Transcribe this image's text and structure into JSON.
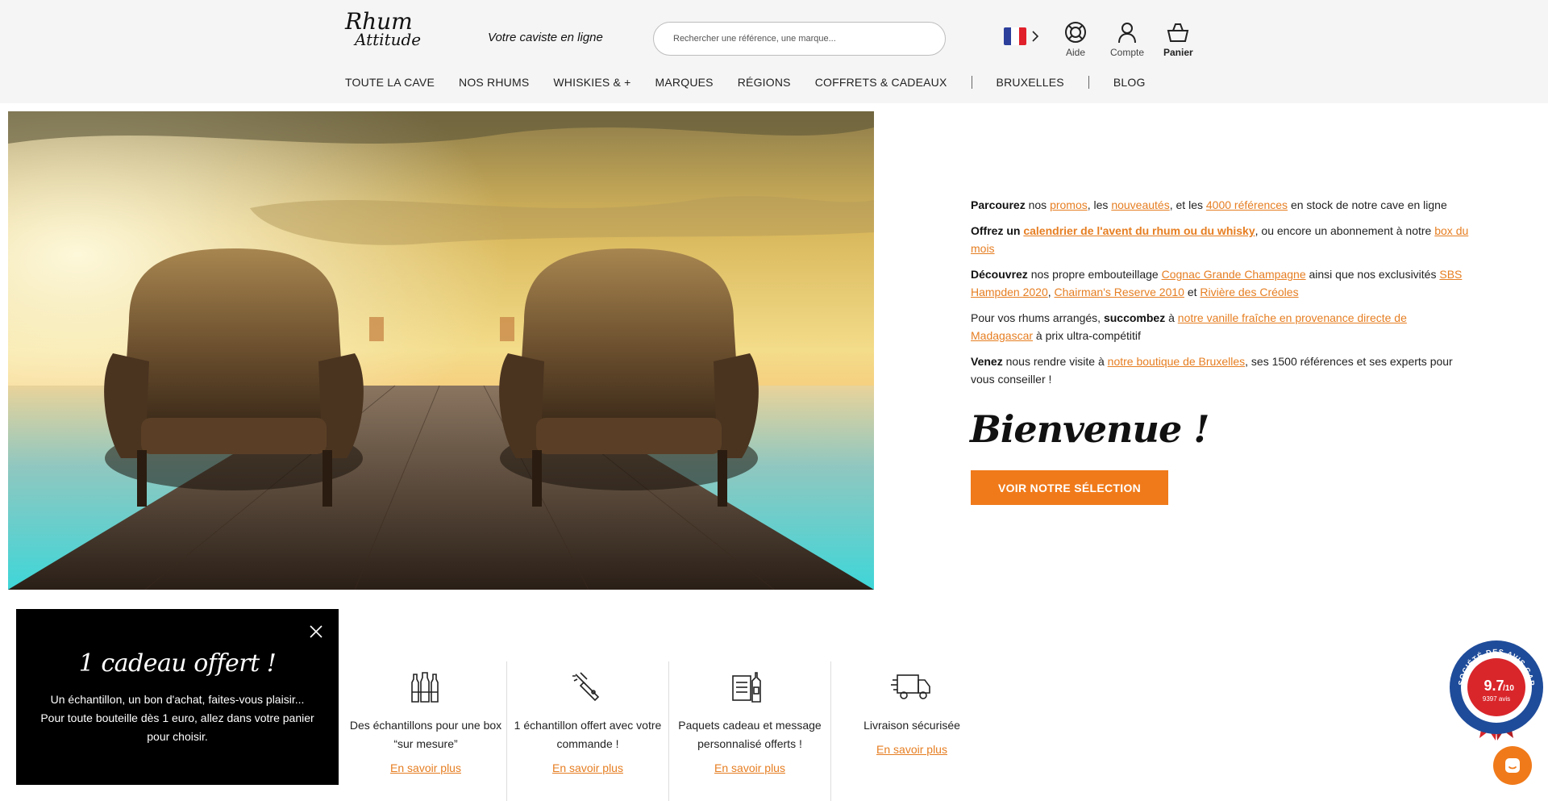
{
  "header": {
    "logo": {
      "line1": "Rhum",
      "line2": "Attitude"
    },
    "tagline": "Votre caviste en ligne",
    "search_placeholder": "Rechercher une référence, une marque...",
    "help_label": "Aide",
    "account_label": "Compte",
    "cart_label": "Panier",
    "flag_colors": [
      "#2b3f9b",
      "#ffffff",
      "#e0202a"
    ]
  },
  "nav": {
    "items": [
      "TOUTE LA CAVE",
      "NOS RHUMS",
      "WHISKIES & +",
      "MARQUES",
      "RÉGIONS",
      "COFFRETS & CADEAUX",
      "BRUXELLES",
      "BLOG"
    ]
  },
  "intro": {
    "p1": {
      "b": "Parcourez",
      "t1": " nos ",
      "l1": "promos",
      "t2": ", les ",
      "l2": "nouveautés",
      "t3": ", et les ",
      "l3": "4000 références",
      "t4": " en stock de notre cave en ligne"
    },
    "p2": {
      "b": "Offrez un ",
      "l1": "calendrier de l'avent du rhum ou du whisky",
      "t1": ", ou encore un abonnement à notre ",
      "l2": "box du mois"
    },
    "p3": {
      "b": "Découvrez",
      "t1": " nos propre embouteillage ",
      "l1": "Cognac Grande Champagne",
      "t2": " ainsi que nos exclusivités ",
      "l2": "SBS Hampden 2020",
      "t3": ", ",
      "l3": "Chairman's Reserve 2010",
      "t4": " et ",
      "l4": "Rivière des Créoles"
    },
    "p4": {
      "t1": "Pour vos rhums arrangés, ",
      "b": "succombez",
      "t2": " à ",
      "l1": "notre vanille fraîche en provenance directe de Madagascar",
      "t3": " à prix ultra-compétitif"
    },
    "p5": {
      "b": "Venez",
      "t1": " nous rendre visite à ",
      "l1": "notre boutique de Bruxelles",
      "t2": ", ses 1500 références et ses experts pour vous conseiller !"
    }
  },
  "welcome": "Bienvenue !",
  "cta_label": "VOIR NOTRE SÉLECTION",
  "features": [
    {
      "icon": "bottles-icon",
      "text": "Des échantillons pour une box “sur mesure”",
      "link": "En savoir plus"
    },
    {
      "icon": "sample-icon",
      "text": "1 échantillon offert avec votre commande !",
      "link": "En savoir plus"
    },
    {
      "icon": "gift-package-icon",
      "text": "Paquets cadeau et message personnalisé offerts !",
      "link": "En savoir plus"
    },
    {
      "icon": "delivery-truck-icon",
      "text": "Livraison sécurisée",
      "link": "En savoir plus"
    }
  ],
  "popup": {
    "title": "1 cadeau offert !",
    "text": "Un échantillon, un bon d'achat, faites-vous plaisir... Pour toute bouteille dès 1 euro, allez dans votre panier pour choisir."
  },
  "badge": {
    "score": "9.7",
    "scale": "/10",
    "reviews": "9397 avis",
    "ring_text": "SOCIÉTÉ DES AVIS GARANTIS"
  },
  "colors": {
    "accent": "#f07a1a",
    "link": "#e67e22"
  }
}
